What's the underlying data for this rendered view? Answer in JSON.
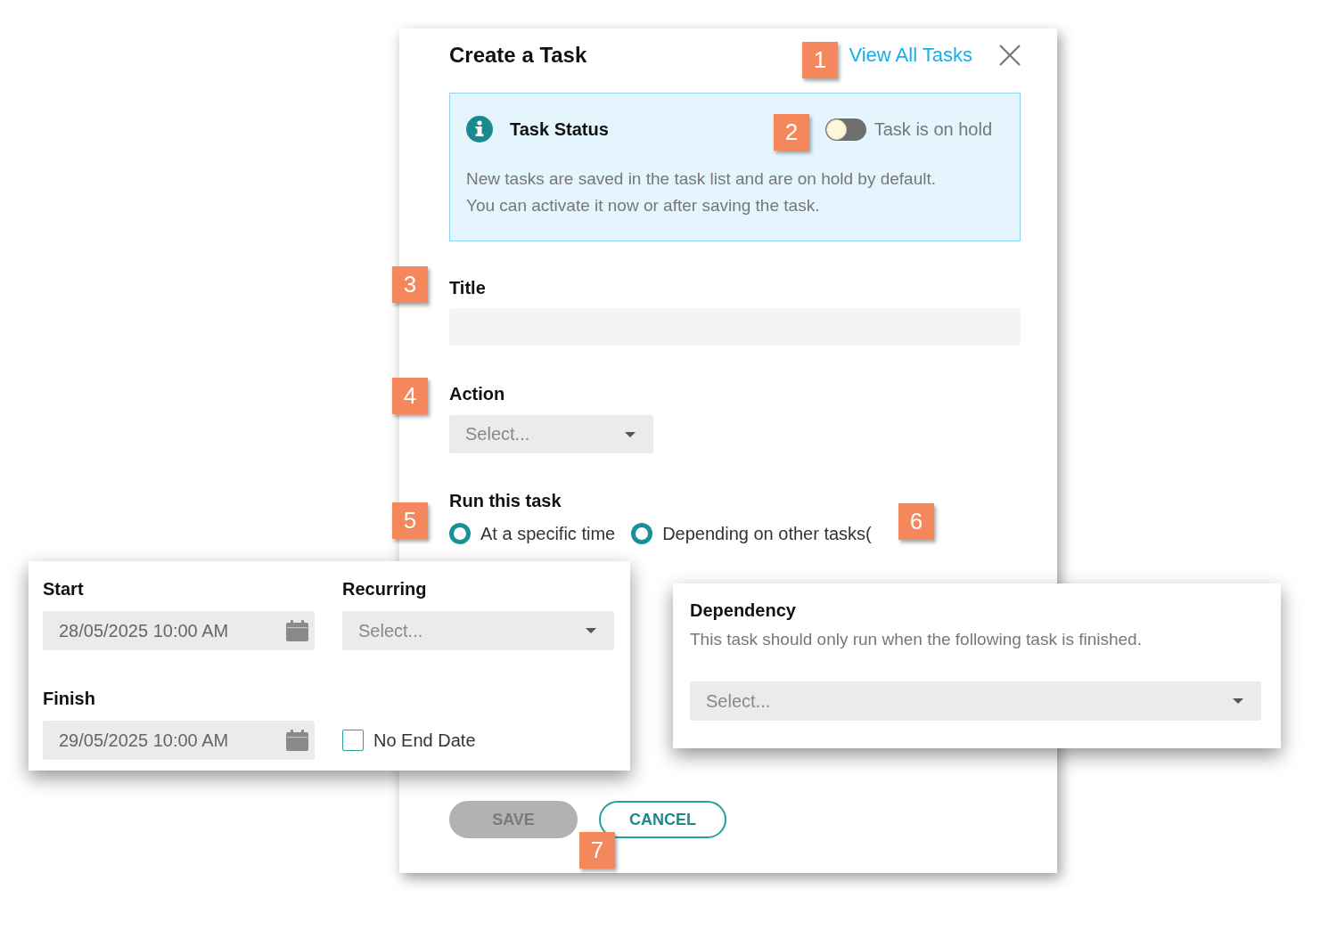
{
  "dialog": {
    "title": "Create a Task",
    "link": "View All Tasks"
  },
  "task_status": {
    "title": "Task Status",
    "toggle": {
      "label": "Task is on hold",
      "on": false
    },
    "description": "New tasks are saved in the task list and are on hold by default.\nYou can activate it now or after saving the task."
  },
  "title_field": {
    "label": "Title"
  },
  "action_field": {
    "label": "Action",
    "placeholder": "Select..."
  },
  "run_task": {
    "label": "Run this task",
    "options": [
      {
        "label": "At a specific time",
        "selected": true
      },
      {
        "label": "Depending on other tasks(",
        "selected": true
      }
    ]
  },
  "buttons": [
    {
      "label": "SAVE",
      "kind": "filled",
      "disabled": true
    },
    {
      "label": "CANCEL",
      "kind": "outline",
      "disabled": false
    }
  ],
  "schedule_panel": {
    "start": {
      "label": "Start",
      "value": "28/05/2025 10:00 AM"
    },
    "recurring": {
      "label": "Recurring",
      "placeholder": "Select..."
    },
    "finish": {
      "label": "Finish",
      "value": "29/05/2025 10:00 AM"
    },
    "no_end_date": {
      "label": "No End Date",
      "checked": false
    }
  },
  "dependency_panel": {
    "title": "Dependency",
    "description": "This task should only run when the following task is finished.",
    "select": {
      "placeholder": "Select..."
    }
  },
  "callouts": [
    {
      "label": "1"
    },
    {
      "label": "2"
    },
    {
      "label": "3"
    },
    {
      "label": "4"
    },
    {
      "label": "5"
    },
    {
      "label": "6"
    },
    {
      "label": "7"
    }
  ]
}
